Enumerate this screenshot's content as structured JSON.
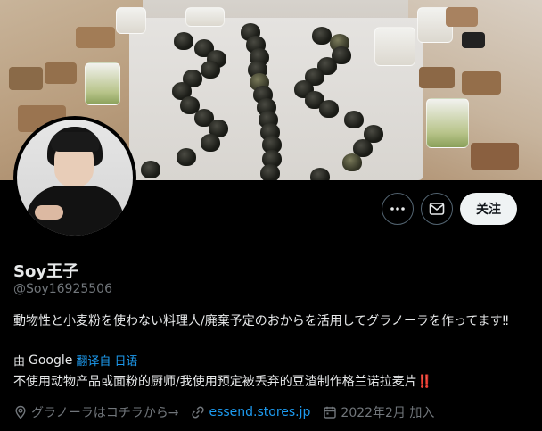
{
  "profile": {
    "display_name": "Soy王子",
    "handle": "@Soy16925506",
    "bio_original": "動物性と小麦粉を使わない料理人/廃棄予定のおからを活用してグラノーラを作ってます‼",
    "translation": {
      "by_label": "由",
      "provider": "Google",
      "translated_from_label": "翻译自 日语"
    },
    "bio_translated": "不使用动物产品或面粉的厨师/我使用预定被丢弃的豆渣制作格兰诺拉麦片",
    "bio_translated_emoji": "‼️",
    "location": "グラノーラはコチラから→",
    "website": "essend.stores.jp",
    "joined": "2022年2月 加入"
  },
  "actions": {
    "more_icon": "more-icon",
    "message_icon": "message-icon",
    "follow_label": "关注"
  },
  "colors": {
    "background": "#000000",
    "link": "#1d9bf0",
    "secondary_text": "#71767b",
    "primary_text": "#e7e9ea",
    "follow_bg": "#eff3f4"
  },
  "icons": {
    "location": "location-pin-icon",
    "website": "link-icon",
    "joined": "calendar-icon"
  }
}
